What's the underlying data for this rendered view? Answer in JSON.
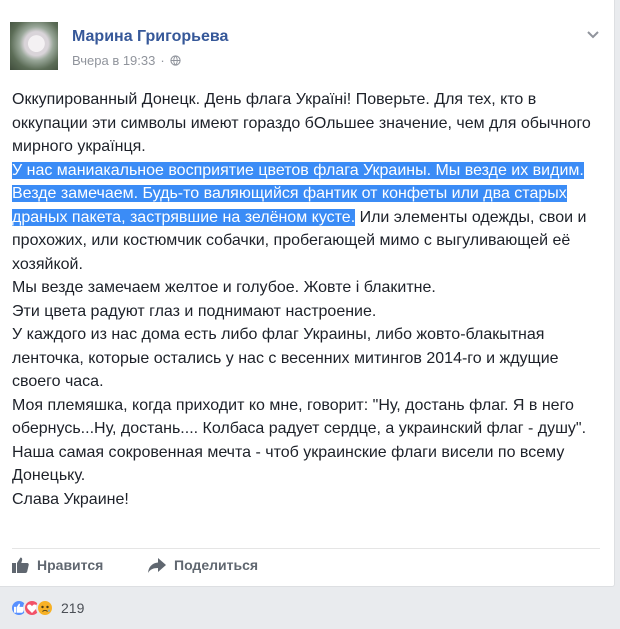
{
  "post": {
    "author": "Марина Григорьева",
    "time": "Вчера в 19:33",
    "separator": "·",
    "paragraphs": [
      {
        "segments": [
          {
            "text": "Оккупированный Донецк. День флага Україні! Поверьте. Для тех, кто в оккупации эти символы имеют гораздо бОльшее значение, чем для обычного мирного українця.",
            "highlight": false
          }
        ]
      },
      {
        "segments": [
          {
            "text": "У нас маниакальное восприятие цветов флага Украины. Мы везде их видим. Везде замечаем. Будь-то валяющийся фантик от конфеты или два старых драных пакета, застрявшие на зелёном кусте.",
            "highlight": true
          },
          {
            "text": " Или элементы одежды, свои и прохожих, или костюмчик собачки, пробегающей мимо с выгуливающей её хозяйкой.",
            "highlight": false
          }
        ]
      },
      {
        "segments": [
          {
            "text": "Мы везде замечаем желтое и голубое. Жовте і блакитне.",
            "highlight": false
          }
        ]
      },
      {
        "segments": [
          {
            "text": "Эти цвета радуют глаз и поднимают настроение.",
            "highlight": false
          }
        ]
      },
      {
        "segments": [
          {
            "text": "У каждого из нас дома есть либо флаг Украины, либо жовто-блакытная ленточка, которые остались у нас с весенних митингов 2014-го и ждущие своего часа.",
            "highlight": false
          }
        ]
      },
      {
        "segments": [
          {
            "text": "Моя племяшка, когда приходит ко мне, говорит: \"Ну, достань флаг. Я в него обернусь...Ну, достань.... Колбаса радует сердце, а украинский флаг - душу\".",
            "highlight": false
          }
        ]
      },
      {
        "segments": [
          {
            "text": "Наша самая сокровенная мечта - чтоб украинские флаги висели по всему Донецьку.",
            "highlight": false
          }
        ]
      },
      {
        "segments": [
          {
            "text": "Слава Украине!",
            "highlight": false
          }
        ]
      }
    ]
  },
  "actions": {
    "like_label": "Нравится",
    "share_label": "Поделиться"
  },
  "reactions": {
    "count": "219",
    "types": [
      "like-icon",
      "love-icon",
      "sad-icon"
    ]
  },
  "colors": {
    "author": "#365899",
    "highlight": "#3b8cf6",
    "like": "#5890ff",
    "love": "#f25268",
    "sad": "#f7b125"
  }
}
